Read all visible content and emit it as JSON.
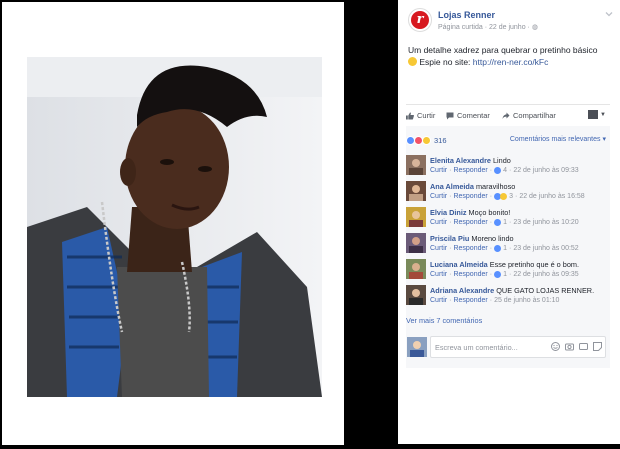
{
  "post": {
    "page_name": "Lojas Renner",
    "meta_label": "Página curtida",
    "meta_date": "22 de junho",
    "text_line1": "Um detalhe xadrez para quebrar o pretinho básico",
    "text_line2_prefix": "Espie no site:",
    "link": "http://ren-ner.co/kFc"
  },
  "actions": {
    "like": "Curtir",
    "comment": "Comentar",
    "share": "Compartilhar"
  },
  "reactions": {
    "count": "316",
    "sort_label": "Comentários mais relevantes"
  },
  "comments": [
    {
      "name": "Elenita Alexandre",
      "text": "Lindo",
      "like_label": "Curtir",
      "reply_label": "Responder",
      "likes": "4",
      "time": "22 de junho às 09:33",
      "reactions": "like"
    },
    {
      "name": "Ana Almeida",
      "text": "maravilhoso",
      "like_label": "Curtir",
      "reply_label": "Responder",
      "likes": "3",
      "time": "22 de junho às 16:58",
      "reactions": "like-wow"
    },
    {
      "name": "Elvia Diniz",
      "text": "Moço bonito!",
      "like_label": "Curtir",
      "reply_label": "Responder",
      "likes": "1",
      "time": "23 de junho às 10:20",
      "reactions": "like"
    },
    {
      "name": "Priscila Piu",
      "text": "Moreno lindo",
      "like_label": "Curtir",
      "reply_label": "Responder",
      "likes": "1",
      "time": "23 de junho às 00:52",
      "reactions": "like"
    },
    {
      "name": "Luciana Almeida",
      "text": "Esse pretinho que é o bom.",
      "like_label": "Curtir",
      "reply_label": "Responder",
      "likes": "1",
      "time": "22 de junho às 09:35",
      "reactions": "like"
    },
    {
      "name": "Adriana Alexandre",
      "text": "QUE GATO LOJAS RENNER.",
      "like_label": "Curtir",
      "reply_label": "Responder",
      "likes": "",
      "time": "25 de junho às 01:10",
      "reactions": "none"
    }
  ],
  "more_comments": "Ver mais 7 comentários",
  "composer": {
    "placeholder": "Escreva um comentário..."
  },
  "colors": {
    "link": "#365899",
    "accent": "#4267b2",
    "brand_red": "#d71920",
    "muted": "#90949c"
  }
}
